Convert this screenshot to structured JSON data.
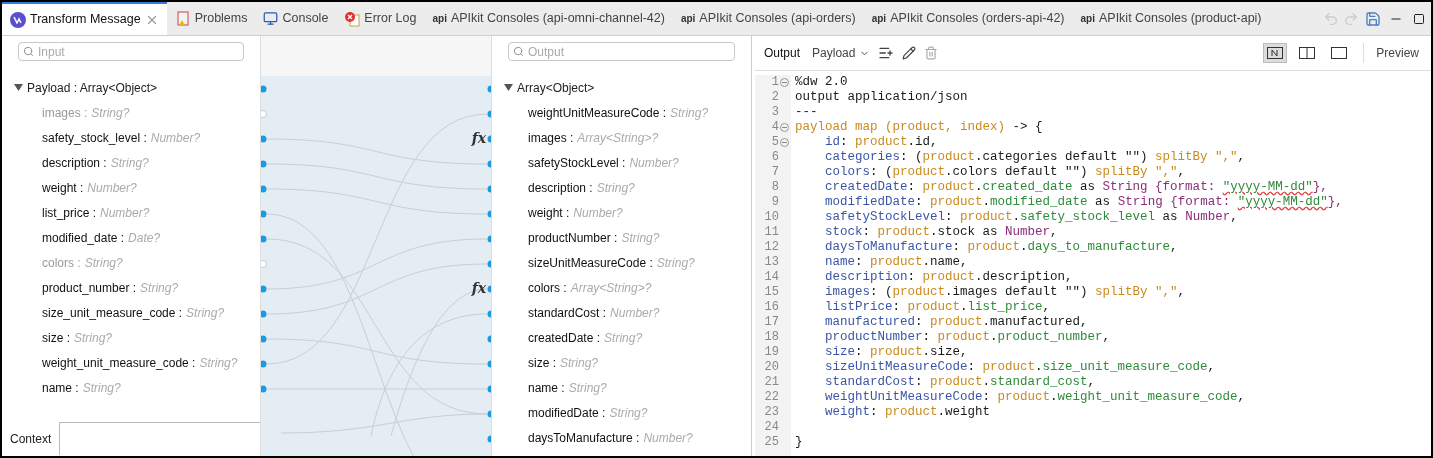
{
  "tabs": [
    {
      "label": "Transform Message",
      "kind": "transform",
      "selected": true
    },
    {
      "label": "Problems",
      "kind": "problems",
      "selected": false
    },
    {
      "label": "Console",
      "kind": "console",
      "selected": false
    },
    {
      "label": "Error Log",
      "kind": "error",
      "selected": false
    },
    {
      "label": "APIkit Consoles (api-omni-channel-42)",
      "kind": "api",
      "badge": "api",
      "selected": false
    },
    {
      "label": "APIkit Consoles (api-orders)",
      "kind": "api",
      "badge": "api",
      "selected": false
    },
    {
      "label": "APIkit Consoles (orders-api-42)",
      "kind": "api",
      "badge": "api",
      "selected": false
    },
    {
      "label": "APIkit Consoles (product-api)",
      "kind": "api",
      "badge": "api",
      "selected": false
    }
  ],
  "input": {
    "search": {
      "placeholder": "Input"
    },
    "root": {
      "label": "Payload : Array<Object>",
      "expanded": true
    },
    "fields": [
      {
        "name": "images :",
        "type": "String?",
        "mapped": false
      },
      {
        "name": "safety_stock_level :",
        "type": "Number?",
        "mapped": true
      },
      {
        "name": "description :",
        "type": "String?",
        "mapped": true
      },
      {
        "name": "weight :",
        "type": "Number?",
        "mapped": true
      },
      {
        "name": "list_price :",
        "type": "Number?",
        "mapped": true
      },
      {
        "name": "modified_date :",
        "type": "Date?",
        "mapped": true
      },
      {
        "name": "colors :",
        "type": "String?",
        "mapped": false
      },
      {
        "name": "product_number :",
        "type": "String?",
        "mapped": true
      },
      {
        "name": "size_unit_measure_code :",
        "type": "String?",
        "mapped": true
      },
      {
        "name": "size :",
        "type": "String?",
        "mapped": true
      },
      {
        "name": "weight_unit_measure_code :",
        "type": "String?",
        "mapped": true
      },
      {
        "name": "name :",
        "type": "String?",
        "mapped": true
      }
    ],
    "bottom_tab": "Context"
  },
  "output": {
    "search": {
      "placeholder": "Output"
    },
    "root": {
      "label": "Array<Object>",
      "expanded": true
    },
    "fields": [
      {
        "name": "weightUnitMeasureCode :",
        "type": "String?"
      },
      {
        "name": "images :",
        "type": "Array<String>?",
        "marker": "fx"
      },
      {
        "name": "safetyStockLevel :",
        "type": "Number?"
      },
      {
        "name": "description :",
        "type": "String?"
      },
      {
        "name": "weight :",
        "type": "Number?"
      },
      {
        "name": "productNumber :",
        "type": "String?"
      },
      {
        "name": "sizeUnitMeasureCode :",
        "type": "String?"
      },
      {
        "name": "colors :",
        "type": "Array<String>?",
        "marker": "fx"
      },
      {
        "name": "standardCost :",
        "type": "Number?"
      },
      {
        "name": "createdDate :",
        "type": "String?"
      },
      {
        "name": "size :",
        "type": "String?"
      },
      {
        "name": "name :",
        "type": "String?"
      },
      {
        "name": "modifiedDate :",
        "type": "String?"
      },
      {
        "name": "daysToManufacture :",
        "type": "Number?"
      }
    ]
  },
  "editor": {
    "toolbar": {
      "title": "Output",
      "target": "Payload",
      "preview": "Preview",
      "layouts": [
        {
          "kind": "code",
          "selected": true
        },
        {
          "kind": "split",
          "selected": false
        },
        {
          "kind": "single",
          "selected": false
        }
      ]
    },
    "lines": [
      {
        "n": "1",
        "fold": true,
        "tokens": [
          {
            "t": "%dw 2.0",
            "kind": "plain"
          }
        ]
      },
      {
        "n": "2",
        "fold": false,
        "tokens": [
          {
            "t": "output application/json",
            "kind": "plain"
          }
        ]
      },
      {
        "n": "3",
        "fold": false,
        "tokens": [
          {
            "t": "---",
            "kind": "plain"
          }
        ]
      },
      {
        "n": "4",
        "fold": true,
        "tokens": [
          {
            "t": "payload map (product, index)",
            "kind": "var"
          },
          {
            "t": " -> {",
            "kind": "plain"
          }
        ]
      },
      {
        "n": "5",
        "fold": true,
        "tokens": [
          {
            "t": "    id",
            "kind": "field"
          },
          {
            "t": ": ",
            "kind": "plain"
          },
          {
            "t": "product",
            "kind": "var"
          },
          {
            "t": ".id,",
            "kind": "plain"
          }
        ]
      },
      {
        "n": "6",
        "fold": false,
        "tokens": [
          {
            "t": "    categories",
            "kind": "field"
          },
          {
            "t": ": (",
            "kind": "plain"
          },
          {
            "t": "product",
            "kind": "var"
          },
          {
            "t": ".categories default \"\") ",
            "kind": "plain"
          },
          {
            "t": "splitBy \",\"",
            "kind": "var"
          },
          {
            "t": ",",
            "kind": "plain"
          }
        ]
      },
      {
        "n": "7",
        "fold": false,
        "tokens": [
          {
            "t": "    colors",
            "kind": "field"
          },
          {
            "t": ": (",
            "kind": "plain"
          },
          {
            "t": "product",
            "kind": "var"
          },
          {
            "t": ".colors default \"\") ",
            "kind": "plain"
          },
          {
            "t": "splitBy \",\"",
            "kind": "var"
          },
          {
            "t": ",",
            "kind": "plain"
          }
        ]
      },
      {
        "n": "8",
        "fold": false,
        "tokens": [
          {
            "t": "    createdDate",
            "kind": "field"
          },
          {
            "t": ": ",
            "kind": "plain"
          },
          {
            "t": "product",
            "kind": "var"
          },
          {
            "t": ".",
            "kind": "plain"
          },
          {
            "t": "created_date",
            "kind": "prop"
          },
          {
            "t": " as ",
            "kind": "plain"
          },
          {
            "t": "String {format: ",
            "kind": "kw"
          },
          {
            "t": "\"yyyy-MM-dd\"",
            "kind": "flagged"
          },
          {
            "t": "},",
            "kind": "kw"
          }
        ]
      },
      {
        "n": "9",
        "fold": false,
        "tokens": [
          {
            "t": "    modifiedDate",
            "kind": "field"
          },
          {
            "t": ": ",
            "kind": "plain"
          },
          {
            "t": "product",
            "kind": "var"
          },
          {
            "t": ".",
            "kind": "plain"
          },
          {
            "t": "modified_date",
            "kind": "prop"
          },
          {
            "t": " as ",
            "kind": "plain"
          },
          {
            "t": "String {format: ",
            "kind": "kw"
          },
          {
            "t": "\"yyyy-MM-dd\"",
            "kind": "flagged"
          },
          {
            "t": "},",
            "kind": "kw"
          }
        ]
      },
      {
        "n": "10",
        "fold": false,
        "tokens": [
          {
            "t": "    safetyStockLevel",
            "kind": "field"
          },
          {
            "t": ": ",
            "kind": "plain"
          },
          {
            "t": "product",
            "kind": "var"
          },
          {
            "t": ".",
            "kind": "plain"
          },
          {
            "t": "safety_stock_level",
            "kind": "prop"
          },
          {
            "t": " as ",
            "kind": "plain"
          },
          {
            "t": "Number",
            "kind": "kw"
          },
          {
            "t": ",",
            "kind": "plain"
          }
        ]
      },
      {
        "n": "11",
        "fold": false,
        "tokens": [
          {
            "t": "    stock",
            "kind": "field"
          },
          {
            "t": ": ",
            "kind": "plain"
          },
          {
            "t": "product",
            "kind": "var"
          },
          {
            "t": ".stock as ",
            "kind": "plain"
          },
          {
            "t": "Number",
            "kind": "kw"
          },
          {
            "t": ",",
            "kind": "plain"
          }
        ]
      },
      {
        "n": "12",
        "fold": false,
        "tokens": [
          {
            "t": "    daysToManufacture",
            "kind": "field"
          },
          {
            "t": ": ",
            "kind": "plain"
          },
          {
            "t": "product",
            "kind": "var"
          },
          {
            "t": ".",
            "kind": "plain"
          },
          {
            "t": "days_to_manufacture",
            "kind": "prop"
          },
          {
            "t": ",",
            "kind": "plain"
          }
        ]
      },
      {
        "n": "13",
        "fold": false,
        "tokens": [
          {
            "t": "    name",
            "kind": "field"
          },
          {
            "t": ": ",
            "kind": "plain"
          },
          {
            "t": "product",
            "kind": "var"
          },
          {
            "t": ".name,",
            "kind": "plain"
          }
        ]
      },
      {
        "n": "14",
        "fold": false,
        "tokens": [
          {
            "t": "    description",
            "kind": "field"
          },
          {
            "t": ": ",
            "kind": "plain"
          },
          {
            "t": "product",
            "kind": "var"
          },
          {
            "t": ".description,",
            "kind": "plain"
          }
        ]
      },
      {
        "n": "15",
        "fold": false,
        "tokens": [
          {
            "t": "    images",
            "kind": "field"
          },
          {
            "t": ": (",
            "kind": "plain"
          },
          {
            "t": "product",
            "kind": "var"
          },
          {
            "t": ".images default \"\") ",
            "kind": "plain"
          },
          {
            "t": "splitBy \",\"",
            "kind": "var"
          },
          {
            "t": ",",
            "kind": "plain"
          }
        ]
      },
      {
        "n": "16",
        "fold": false,
        "tokens": [
          {
            "t": "    listPrice",
            "kind": "field"
          },
          {
            "t": ": ",
            "kind": "plain"
          },
          {
            "t": "product",
            "kind": "var"
          },
          {
            "t": ".",
            "kind": "plain"
          },
          {
            "t": "list_price",
            "kind": "prop"
          },
          {
            "t": ",",
            "kind": "plain"
          }
        ]
      },
      {
        "n": "17",
        "fold": false,
        "tokens": [
          {
            "t": "    manufactured",
            "kind": "field"
          },
          {
            "t": ": ",
            "kind": "plain"
          },
          {
            "t": "product",
            "kind": "var"
          },
          {
            "t": ".manufactured,",
            "kind": "plain"
          }
        ]
      },
      {
        "n": "18",
        "fold": false,
        "tokens": [
          {
            "t": "    productNumber",
            "kind": "field"
          },
          {
            "t": ": ",
            "kind": "plain"
          },
          {
            "t": "product",
            "kind": "var"
          },
          {
            "t": ".",
            "kind": "plain"
          },
          {
            "t": "product_number",
            "kind": "prop"
          },
          {
            "t": ",",
            "kind": "plain"
          }
        ]
      },
      {
        "n": "19",
        "fold": false,
        "tokens": [
          {
            "t": "    size",
            "kind": "field"
          },
          {
            "t": ": ",
            "kind": "plain"
          },
          {
            "t": "product",
            "kind": "var"
          },
          {
            "t": ".size,",
            "kind": "plain"
          }
        ]
      },
      {
        "n": "20",
        "fold": false,
        "tokens": [
          {
            "t": "    sizeUnitMeasureCode",
            "kind": "field"
          },
          {
            "t": ": ",
            "kind": "plain"
          },
          {
            "t": "product",
            "kind": "var"
          },
          {
            "t": ".",
            "kind": "plain"
          },
          {
            "t": "size_unit_measure_code",
            "kind": "prop"
          },
          {
            "t": ",",
            "kind": "plain"
          }
        ]
      },
      {
        "n": "21",
        "fold": false,
        "tokens": [
          {
            "t": "    standardCost",
            "kind": "field"
          },
          {
            "t": ": ",
            "kind": "plain"
          },
          {
            "t": "product",
            "kind": "var"
          },
          {
            "t": ".",
            "kind": "plain"
          },
          {
            "t": "standard_cost",
            "kind": "prop"
          },
          {
            "t": ",",
            "kind": "plain"
          }
        ]
      },
      {
        "n": "22",
        "fold": false,
        "tokens": [
          {
            "t": "    weightUnitMeasureCode",
            "kind": "field"
          },
          {
            "t": ": ",
            "kind": "plain"
          },
          {
            "t": "product",
            "kind": "var"
          },
          {
            "t": ".",
            "kind": "plain"
          },
          {
            "t": "weight_unit_measure_code",
            "kind": "prop"
          },
          {
            "t": ",",
            "kind": "plain"
          }
        ]
      },
      {
        "n": "23",
        "fold": false,
        "tokens": [
          {
            "t": "    weight",
            "kind": "field"
          },
          {
            "t": ": ",
            "kind": "plain"
          },
          {
            "t": "product",
            "kind": "var"
          },
          {
            "t": ".weight",
            "kind": "plain"
          }
        ]
      },
      {
        "n": "24",
        "fold": false
      },
      {
        "n": "25",
        "fold": false,
        "tokens": [
          {
            "t": "}",
            "kind": "plain"
          }
        ]
      }
    ]
  }
}
